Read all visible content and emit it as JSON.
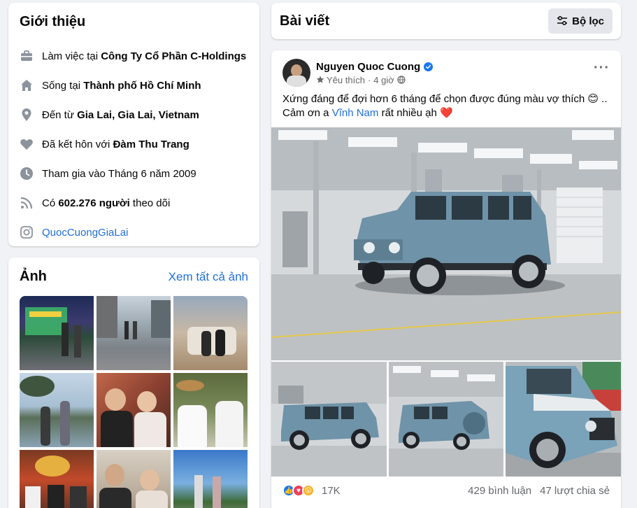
{
  "intro": {
    "title": "Giới thiệu",
    "work_prefix": "Làm việc tại ",
    "work_place": "Công Ty Cổ Phần C-Holdings",
    "live_prefix": "Sống tại ",
    "live_place": "Thành phố Hồ Chí Minh",
    "from_prefix": "Đến từ ",
    "from_place": "Gia Lai, Gia Lai, Vietnam",
    "married_prefix": "Đã kết hôn với ",
    "married_name": "Đàm Thu Trang",
    "joined": "Tham gia vào Tháng 6 năm 2009",
    "followers_prefix": "Có ",
    "followers_count": "602.276 người",
    "followers_suffix": " theo dõi",
    "instagram": "QuocCuongGiaLai"
  },
  "photos": {
    "title": "Ảnh",
    "see_all": "Xem tất cả ảnh"
  },
  "posts": {
    "title": "Bài viết",
    "filter_label": "Bộ lọc"
  },
  "post": {
    "author": "Nguyen Quoc Cuong",
    "audience": "Yêu thích",
    "time": "4 giờ",
    "text_line1": "Xứng đáng để đợi hơn 6 tháng để chọn được đúng màu vợ thích 😊 ..",
    "text_line2_prefix": "Cảm ơn a ",
    "mention": "Vĩnh Nam",
    "text_line2_suffix": " rất nhiều ạh ❤️",
    "reaction_count": "17K",
    "comments": "429 bình luận",
    "shares": "47 lượt chia sẻ"
  },
  "colors": {
    "link": "#216fdb",
    "background": "#f0f2f5",
    "car_blue": "#6f93a8"
  }
}
